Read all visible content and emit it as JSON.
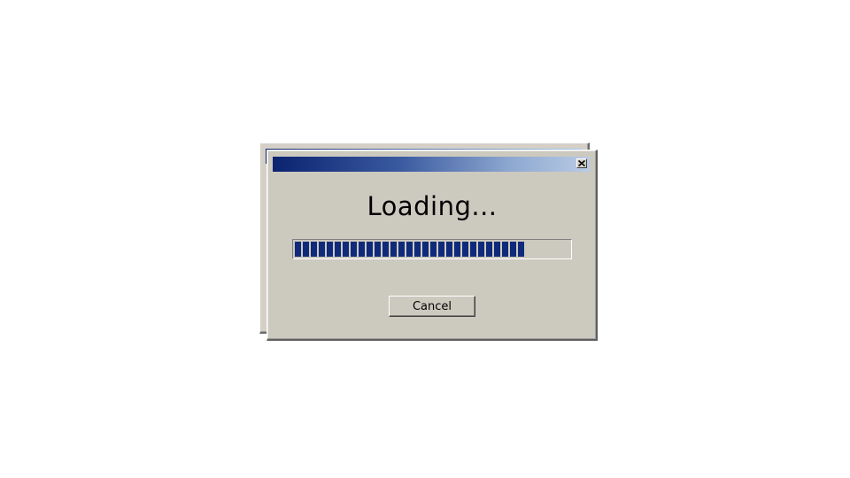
{
  "dialog": {
    "title": "",
    "message": "Loading...",
    "progress_fraction": 0.84,
    "cancel_label": "Cancel",
    "close_icon": "close-icon"
  },
  "colors": {
    "dialog_face": "#ccc9bf",
    "titlebar_start": "#0b2370",
    "titlebar_end": "#b9cbe6",
    "progress_block": "#0f2a7a",
    "background": "#ffffff"
  }
}
